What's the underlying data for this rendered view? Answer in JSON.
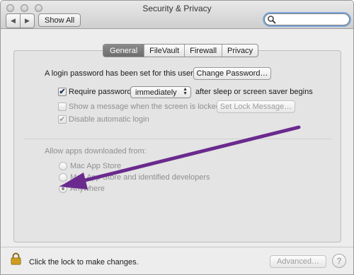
{
  "window": {
    "title": "Security & Privacy"
  },
  "toolbar": {
    "show_all": "Show All",
    "search_placeholder": ""
  },
  "tabs": [
    {
      "label": "General",
      "active": true
    },
    {
      "label": "FileVault",
      "active": false
    },
    {
      "label": "Firewall",
      "active": false
    },
    {
      "label": "Privacy",
      "active": false
    }
  ],
  "general": {
    "login_password_text": "A login password has been set for this user",
    "change_password_button": "Change Password…",
    "require_password_label": "Require password",
    "require_password_checked": true,
    "require_password_value": "immediately",
    "after_sleep_text": "after sleep or screen saver begins",
    "show_message_label": "Show a message when the screen is locked",
    "set_lock_message_button": "Set Lock Message…",
    "disable_auto_login_label": "Disable automatic login",
    "disable_auto_login_checked": true
  },
  "apps": {
    "heading": "Allow apps downloaded from:",
    "options": [
      {
        "label": "Mac App Store",
        "selected": false
      },
      {
        "label": "Mac App Store and identified developers",
        "selected": false
      },
      {
        "label": "Anywhere",
        "selected": true
      }
    ]
  },
  "footer": {
    "lock_text": "Click the lock to make changes.",
    "advanced_button": "Advanced…",
    "help_glyph": "?"
  },
  "colors": {
    "annotation_arrow": "#6a2a8e",
    "search_focus": "#7eaadd"
  }
}
